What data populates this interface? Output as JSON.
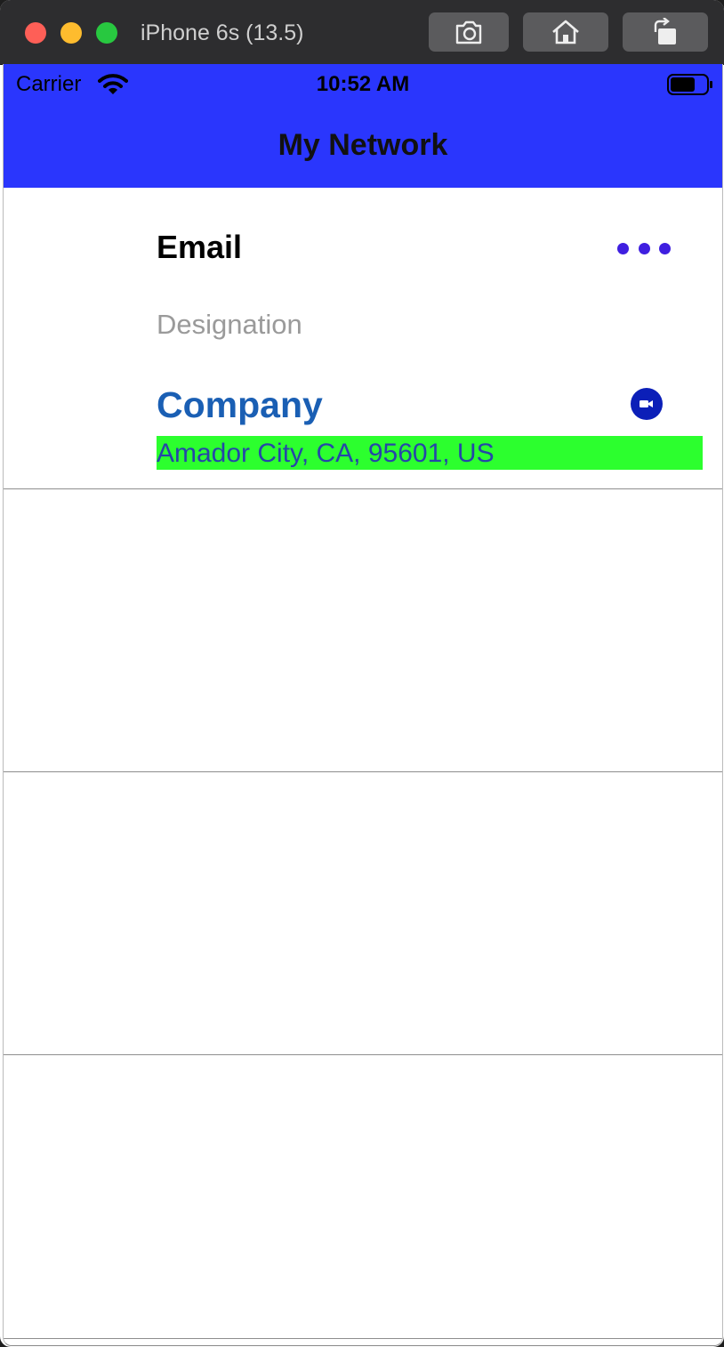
{
  "window": {
    "title": "iPhone 6s (13.5)"
  },
  "toolbar": {
    "screenshot_icon": "camera-icon",
    "home_icon": "home-icon",
    "rotate_icon": "rotate-icon"
  },
  "status_bar": {
    "carrier": "Carrier",
    "time": "10:52 AM"
  },
  "nav": {
    "title": "My Network",
    "background": "#2a36fd"
  },
  "contact": {
    "email": "Email",
    "designation": "Designation",
    "company": "Company",
    "address": "Amador City, CA, 95601, US",
    "more_icon": "ellipsis-icon",
    "video_icon": "video-call-icon",
    "address_background": "#2cff2e"
  }
}
